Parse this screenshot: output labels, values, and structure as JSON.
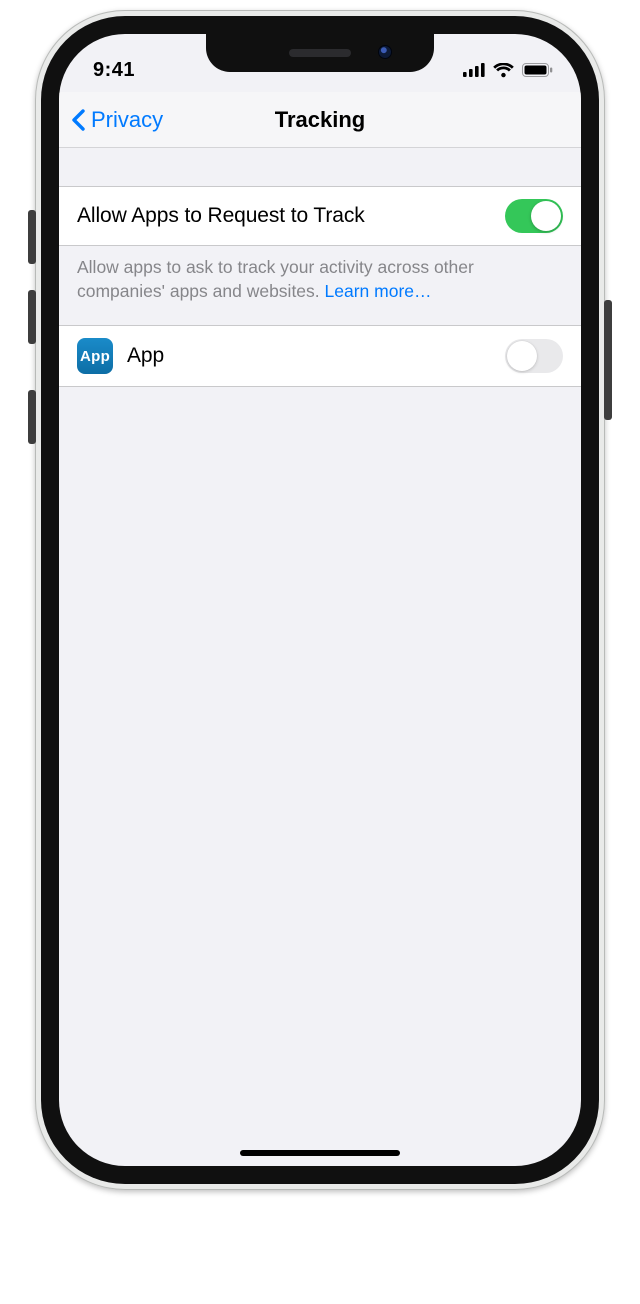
{
  "status": {
    "time": "9:41"
  },
  "nav": {
    "back_label": "Privacy",
    "title": "Tracking"
  },
  "rows": {
    "allow": {
      "label": "Allow Apps to Request to Track",
      "enabled": true
    },
    "app": {
      "icon_label": "App",
      "label": "App",
      "enabled": false
    }
  },
  "footer": {
    "text": "Allow apps to ask to track your activity across other companies' apps and websites. ",
    "learn_more": "Learn more…"
  }
}
